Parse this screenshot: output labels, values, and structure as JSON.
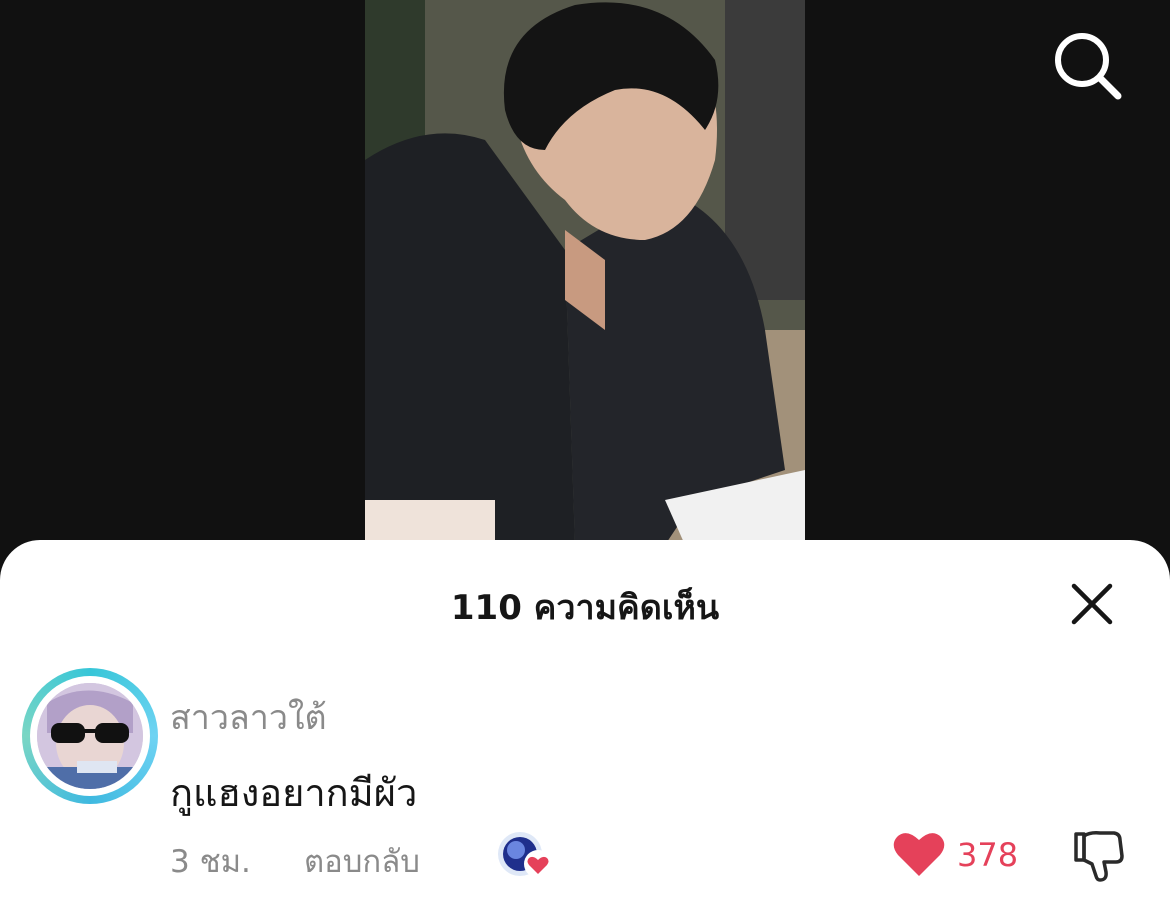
{
  "video": {
    "background_color": "#111111"
  },
  "search": {
    "icon": "search-icon"
  },
  "comments_panel": {
    "title": "110 ความคิดเห็น",
    "close_icon": "close-icon"
  },
  "comment": {
    "username": "สาวลาวใต้",
    "text": "กูแฮงอยากมีผัว",
    "time": "3 ชม.",
    "reply_label": "ตอบกลับ",
    "creator_liked_icon": "creator-liked-icon",
    "like_icon": "heart-icon",
    "like_count": "378",
    "like_color": "#e5415a",
    "dislike_icon": "thumbs-down-icon"
  }
}
